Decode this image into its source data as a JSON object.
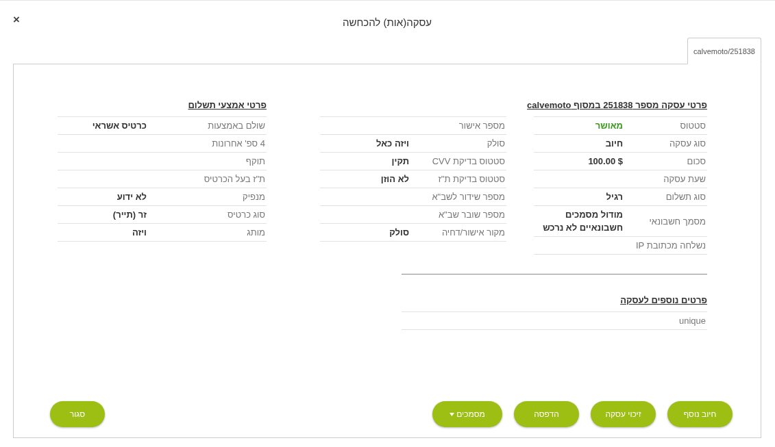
{
  "dialog": {
    "title": "עסקה(אות) להכחשה",
    "close": "×"
  },
  "tabs": [
    {
      "label": "calvemoto/251838",
      "selected": true
    }
  ],
  "transaction": {
    "heading": "פרטי עסקה מספר 251838 במסוף calvemoto",
    "rows": [
      {
        "label": "סטטוס",
        "value": "מאושר",
        "color": "#3a9a1e"
      },
      {
        "label": "סוג עסקה",
        "value": "חיוב"
      },
      {
        "label": "סכום",
        "value": "$ 100.00"
      },
      {
        "label": "שעת עסקה"
      },
      {
        "label": "סוג תשלום",
        "value": "רגיל"
      },
      {
        "label": "מסמך חשבונאי",
        "value": "מודול מסמכים חשבונאיים לא נרכש"
      },
      {
        "label": "נשלחה מכתובת IP"
      }
    ],
    "rows_2": [
      {
        "label": "מספר אישור"
      },
      {
        "label": "סולק",
        "value": "ויזה כאל"
      },
      {
        "label": "סטטוס בדיקת CVV",
        "value": "תקין"
      },
      {
        "label": "סטטוס בדיקת ת\"ז",
        "value": "לא הוזן"
      },
      {
        "label": "מספר שידור לשב\"א"
      },
      {
        "label": "מספר שובר שב\"א"
      },
      {
        "label": "מקור אישור/דחיה",
        "value": "סולק"
      }
    ]
  },
  "additional": {
    "heading": "פרטים נוספים לעסקה",
    "rows": [
      {
        "label": "unique"
      }
    ]
  },
  "payment": {
    "heading": "פרטי אמצעי תשלום",
    "rows": [
      {
        "label": "שולם באמצעות",
        "value": "כרטיס אשראי"
      },
      {
        "label": "4 ספ' אחרונות"
      },
      {
        "label": "תוקף"
      },
      {
        "label": "ת\"ז בעל הכרטיס"
      },
      {
        "label": "מנפיק",
        "value": "לא ידוע"
      },
      {
        "label": "סוג כרטיס",
        "value": "זר (תייר)"
      },
      {
        "label": "מותג",
        "value": "ויזה"
      }
    ]
  },
  "actions": [
    {
      "kind": "button",
      "label": "חיוב נוסף"
    },
    {
      "kind": "button",
      "label": "זיכוי עסקה"
    },
    {
      "kind": "button",
      "label": "הדפסה"
    },
    {
      "kind": "dropdown",
      "label": "מסמכים"
    }
  ],
  "close_button": "סגור"
}
